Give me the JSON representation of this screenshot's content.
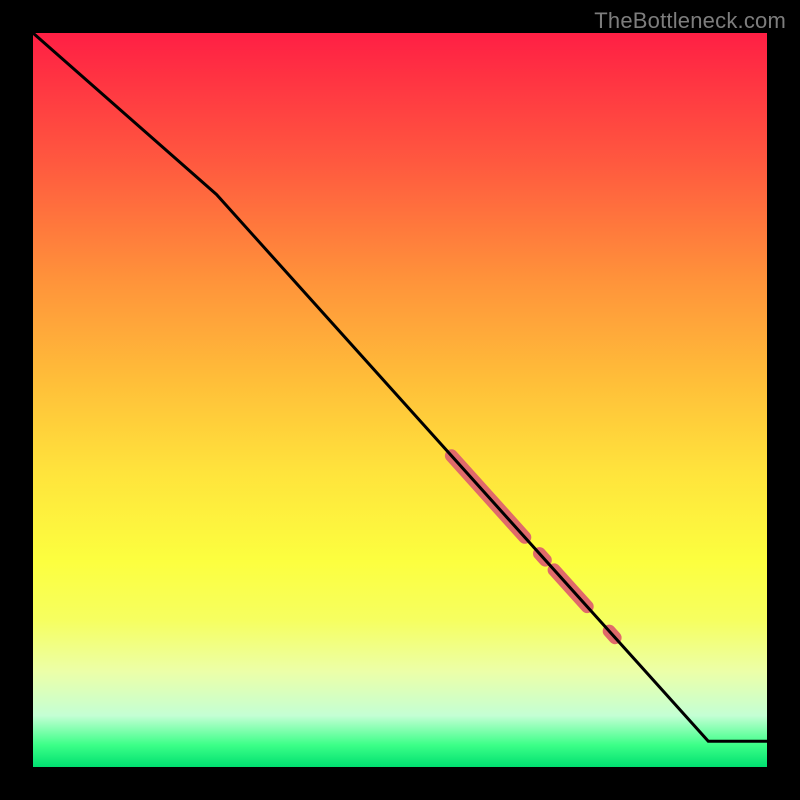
{
  "watermark": "TheBottleneck.com",
  "colors": {
    "line": "#000000",
    "marker": "#e06a6a",
    "background_black": "#000000"
  },
  "chart_data": {
    "type": "line",
    "title": "",
    "xlabel": "",
    "ylabel": "",
    "xlim": [
      0,
      100
    ],
    "ylim": [
      0,
      100
    ],
    "grid": false,
    "legend": false,
    "series": [
      {
        "name": "curve",
        "x": [
          0,
          25,
          92,
          100
        ],
        "y": [
          100,
          78,
          3.5,
          3.5
        ],
        "note": "y is relative height from bottom; first segment has a shallower slope than the main diagonal; curve flattens near the right edge"
      }
    ],
    "highlighted_segments": [
      {
        "x_start": 57,
        "x_end": 67,
        "note": "thick pink segment along the line"
      },
      {
        "x_start": 69,
        "x_end": 69.8,
        "note": "small pink blob"
      },
      {
        "x_start": 71,
        "x_end": 75.5,
        "note": "thick pink segment"
      },
      {
        "x_start": 78.5,
        "x_end": 79.3,
        "note": "small pink dot"
      }
    ]
  }
}
